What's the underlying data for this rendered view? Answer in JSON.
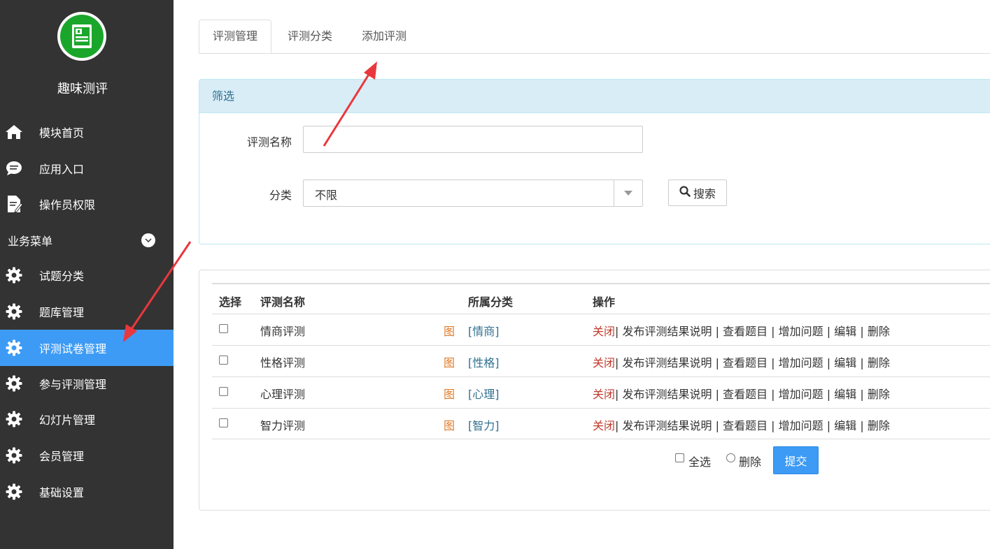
{
  "sidebar": {
    "app_name": "趣味测评",
    "top_items": [
      {
        "label": "模块首页",
        "icon": "home-icon"
      },
      {
        "label": "应用入口",
        "icon": "chat-icon"
      },
      {
        "label": "操作员权限",
        "icon": "document-edit-icon"
      }
    ],
    "section_label": "业务菜单",
    "section_items": [
      {
        "label": "试题分类",
        "icon": "gear-icon"
      },
      {
        "label": "题库管理",
        "icon": "gear-icon"
      },
      {
        "label": "评测试卷管理",
        "icon": "gear-icon",
        "active": true
      },
      {
        "label": "参与评测管理",
        "icon": "gear-icon"
      },
      {
        "label": "幻灯片管理",
        "icon": "gear-icon"
      },
      {
        "label": "会员管理",
        "icon": "gear-icon"
      },
      {
        "label": "基础设置",
        "icon": "gear-icon"
      }
    ],
    "active_color": "#3d9bf5",
    "background_color": "#333333"
  },
  "tabs": [
    {
      "label": "评测管理",
      "active": true
    },
    {
      "label": "评测分类",
      "active": false
    },
    {
      "label": "添加评测",
      "active": false
    }
  ],
  "filter": {
    "title": "筛选",
    "name_label": "评测名称",
    "name_value": "",
    "category_label": "分类",
    "category_value": "不限",
    "search_label": "搜索"
  },
  "table": {
    "headers": {
      "select": "选择",
      "name": "评测名称",
      "category": "所属分类",
      "actions": "操作"
    },
    "rows": [
      {
        "name": "情商评测",
        "img": "图",
        "category": "[情商]"
      },
      {
        "name": "性格评测",
        "img": "图",
        "category": "[性格]"
      },
      {
        "name": "心理评测",
        "img": "图",
        "category": "[心理]"
      },
      {
        "name": "智力评测",
        "img": "图",
        "category": "[智力]"
      }
    ],
    "actions": {
      "close": "关闭",
      "publish": "发布评测结果说明",
      "view": "查看题目",
      "add": "增加问题",
      "edit": "编辑",
      "delete": "删除"
    },
    "select_all_label": "全选",
    "delete_option_label": "删除",
    "submit_label": "提交"
  }
}
